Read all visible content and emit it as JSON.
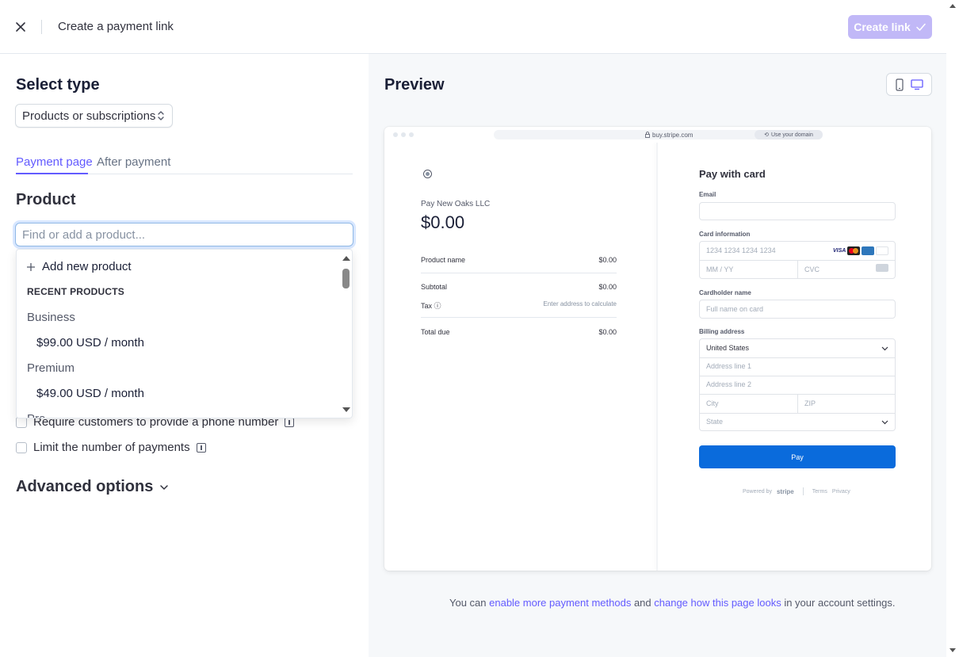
{
  "topbar": {
    "title": "Create a payment link",
    "create_button_label": "Create link"
  },
  "left": {
    "select_type_heading": "Select type",
    "type_select_value": "Products or subscriptions",
    "tabs": [
      {
        "label": "Payment page",
        "active": true
      },
      {
        "label": "After payment",
        "active": false
      }
    ],
    "product_heading": "Product",
    "product_search_placeholder": "Find or add a product...",
    "dropdown": {
      "add_label": "Add new product",
      "section_label": "RECENT PRODUCTS",
      "products": [
        {
          "name": "Business",
          "price": "$99.00 USD / month"
        },
        {
          "name": "Premium",
          "price": "$49.00 USD / month"
        },
        {
          "name": "Pro"
        }
      ]
    },
    "options": [
      {
        "label": "Require customers to provide a phone number",
        "checked": false
      },
      {
        "label": "Limit the number of payments",
        "checked": false
      }
    ],
    "advanced_options_label": "Advanced options"
  },
  "right": {
    "preview_heading": "Preview",
    "browser": {
      "url": "buy.stripe.com",
      "domain_pill": "Use your domain"
    },
    "checkout": {
      "merchant": "Pay New Oaks LLC",
      "amount": "$0.00",
      "product_name_label": "Product name",
      "product_name_value": "$0.00",
      "subtotal_label": "Subtotal",
      "subtotal_value": "$0.00",
      "tax_label": "Tax",
      "tax_value": "Enter address to calculate",
      "total_label": "Total due",
      "total_value": "$0.00"
    },
    "pay_form": {
      "title": "Pay with card",
      "email_label": "Email",
      "card_label": "Card information",
      "card_number_placeholder": "1234 1234 1234 1234",
      "expiry_placeholder": "MM / YY",
      "cvc_placeholder": "CVC",
      "cardholder_label": "Cardholder name",
      "cardholder_placeholder": "Full name on card",
      "billing_label": "Billing address",
      "country": "United States",
      "address1_placeholder": "Address line 1",
      "address2_placeholder": "Address line 2",
      "city_placeholder": "City",
      "zip_placeholder": "ZIP",
      "state_placeholder": "State",
      "pay_button": "Pay",
      "powered_by": "Powered by",
      "stripe": "stripe",
      "terms": "Terms",
      "privacy": "Privacy"
    },
    "footnote": {
      "prefix": "You can ",
      "link1": "enable more payment methods",
      "middle": " and ",
      "link2": "change how this page looks",
      "suffix": " in your account settings."
    }
  },
  "colors": {
    "accent": "#635bff",
    "create_button_bg": "#c1b8f7",
    "pay_button_bg": "#0a6bdc"
  }
}
